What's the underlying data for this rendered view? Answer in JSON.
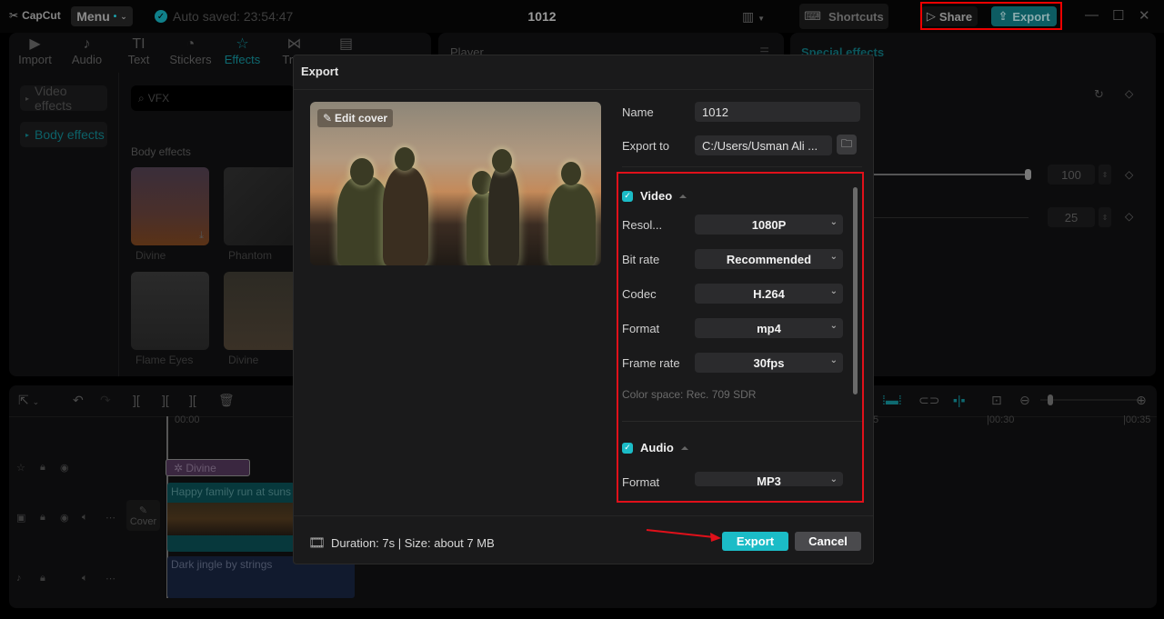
{
  "app": {
    "logo": "CapCut",
    "menu_label": "Menu",
    "autosave": "Auto saved: 23:54:47",
    "project_title": "1012",
    "shortcuts_label": "Shortcuts",
    "share_label": "Share",
    "export_label": "Export"
  },
  "media_tabs": [
    {
      "label": "Import",
      "icon": "import-icon"
    },
    {
      "label": "Audio",
      "icon": "audio-icon"
    },
    {
      "label": "Text",
      "icon": "text-icon"
    },
    {
      "label": "Stickers",
      "icon": "stickers-icon"
    },
    {
      "label": "Effects",
      "icon": "effects-icon",
      "active": true
    },
    {
      "label": "Tran",
      "icon": "transitions-icon"
    },
    {
      "label": "",
      "icon": "captions-icon"
    }
  ],
  "effects_sidebar": [
    {
      "label": "Video effects"
    },
    {
      "label": "Body effects",
      "active": true
    }
  ],
  "search": {
    "value": "VFX"
  },
  "effects_section_title": "Body effects",
  "effects": [
    {
      "name": "Divine"
    },
    {
      "name": "Phantom"
    },
    {
      "name": "Flame Eyes"
    },
    {
      "name": "Divine"
    }
  ],
  "player": {
    "label": "Player"
  },
  "properties": {
    "title": "Special effects",
    "param1_value": "100",
    "param2_value": "25",
    "param1_fraction": 1.0
  },
  "timeline": {
    "time_start": "00:00",
    "time_30": "|00:30",
    "time_35": "|00:35",
    "time_25": "5",
    "effect_clip": "Divine",
    "video_clip": "Happy family run at suns",
    "audio_clip": "Dark jingle by strings",
    "cover_label": "Cover"
  },
  "export_dialog": {
    "title": "Export",
    "edit_cover": "Edit cover",
    "name_label": "Name",
    "name_value": "1012",
    "export_to_label": "Export to",
    "export_to_value": "C:/Users/Usman Ali ...",
    "video": {
      "label": "Video",
      "checked": true,
      "resolution_label": "Resol...",
      "resolution_value": "1080P",
      "bitrate_label": "Bit rate",
      "bitrate_value": "Recommended",
      "codec_label": "Codec",
      "codec_value": "H.264",
      "format_label": "Format",
      "format_value": "mp4",
      "framerate_label": "Frame rate",
      "framerate_value": "30fps",
      "color_space": "Color space: Rec. 709 SDR"
    },
    "audio": {
      "label": "Audio",
      "checked": true,
      "format_label": "Format",
      "format_value": "MP3"
    },
    "footer_info": "Duration: 7s | Size: about 7 MB",
    "export_button": "Export",
    "cancel_button": "Cancel"
  },
  "colors": {
    "accent": "#1bbcc7",
    "highlight_box": "#e0101a"
  }
}
